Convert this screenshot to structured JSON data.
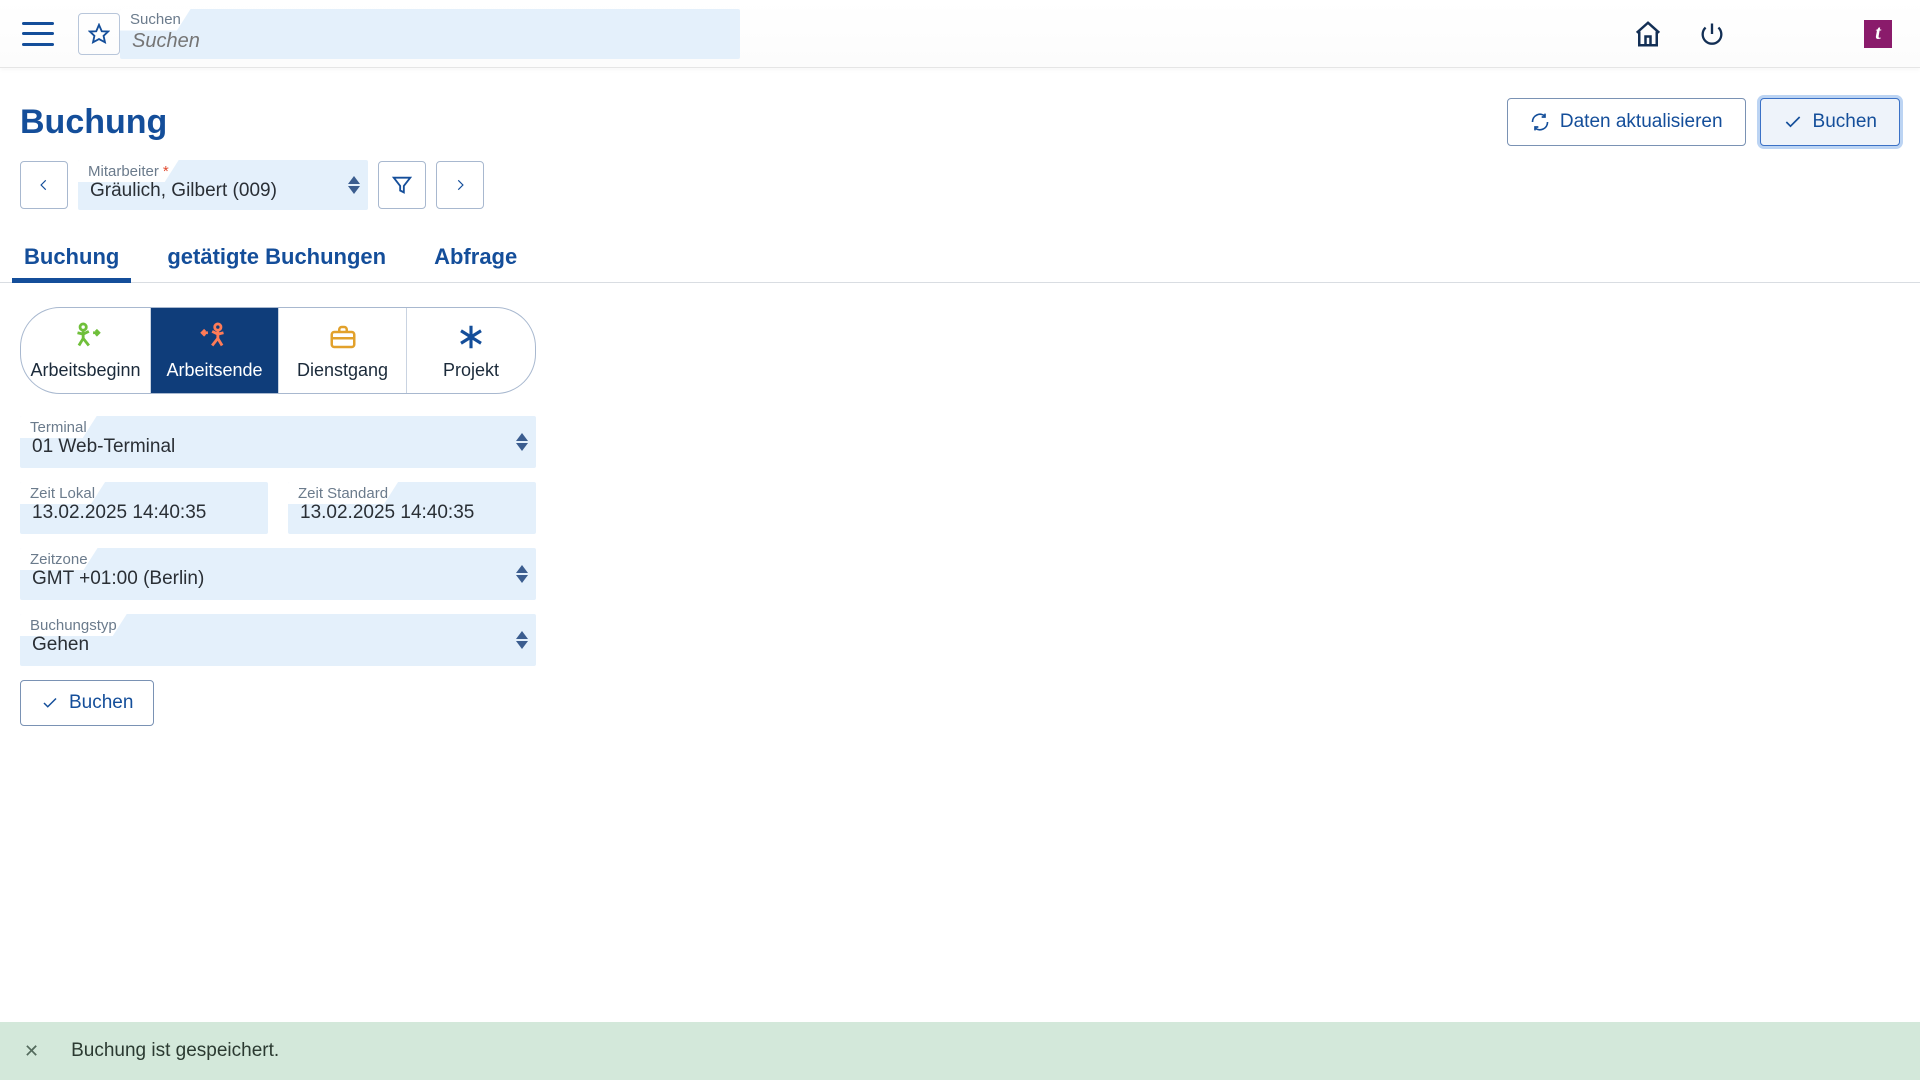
{
  "header": {
    "search_label": "Suchen",
    "search_placeholder": "Suchen"
  },
  "page": {
    "title": "Buchung",
    "actions": {
      "refresh": "Daten aktualisieren",
      "book": "Buchen"
    }
  },
  "employee_selector": {
    "label": "Mitarbeiter",
    "value": "Gräulich, Gilbert (009)"
  },
  "tabs": [
    {
      "label": "Buchung",
      "active": true
    },
    {
      "label": "getätigte Buchungen",
      "active": false
    },
    {
      "label": "Abfrage",
      "active": false
    }
  ],
  "tiles": [
    {
      "label": "Arbeitsbeginn"
    },
    {
      "label": "Arbeitsende"
    },
    {
      "label": "Dienstgang"
    },
    {
      "label": "Projekt"
    }
  ],
  "form": {
    "terminal_label": "Terminal",
    "terminal_value": "01 Web-Terminal",
    "time_local_label": "Zeit Lokal",
    "time_local_value": "13.02.2025  14:40:35",
    "time_std_label": "Zeit Standard",
    "time_std_value": "13.02.2025  14:40:35",
    "timezone_label": "Zeitzone",
    "timezone_value": "GMT +01:00 (Berlin)",
    "booking_type_label": "Buchungstyp",
    "booking_type_value": "Gehen",
    "submit_label": "Buchen"
  },
  "notice": {
    "message": "Buchung ist gespeichert."
  }
}
